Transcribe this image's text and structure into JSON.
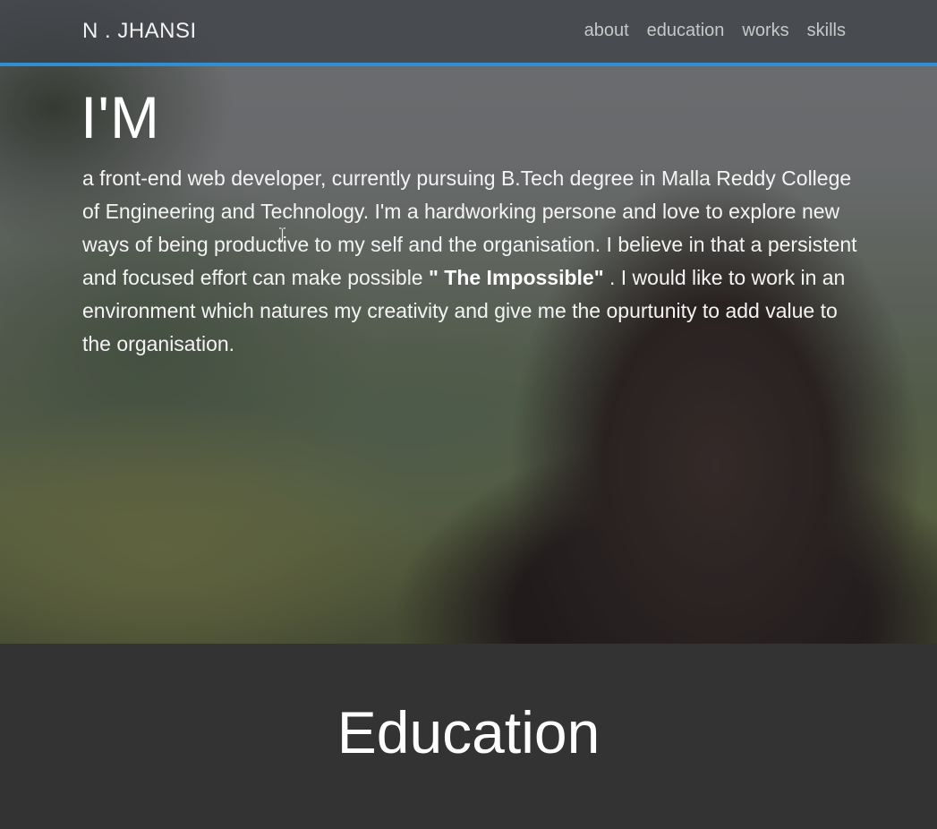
{
  "nav": {
    "brand": "N . JHANSI",
    "links": [
      {
        "label": "about"
      },
      {
        "label": "education"
      },
      {
        "label": "works"
      },
      {
        "label": "skills"
      }
    ]
  },
  "hero": {
    "heading": "I'M",
    "intro_before": "a front-end web developer, currently pursuing B.Tech degree in Malla Reddy College of Engineering and Technology. I'm a hardworking persone and love to explore new ways of being productive to my self and the organisation. I believe in that a persistent and focused effort can make possible ",
    "intro_emphasis": "\" The Impossible\"",
    "intro_after": " . I would like to work in an environment which natures my creativity and give me the opurtunity to add value to the organisation."
  },
  "education": {
    "title": "Education"
  },
  "colors": {
    "accent": "#2e8fd4",
    "section_background": "#333333"
  },
  "icons": {
    "cursor": "text-cursor-icon"
  }
}
